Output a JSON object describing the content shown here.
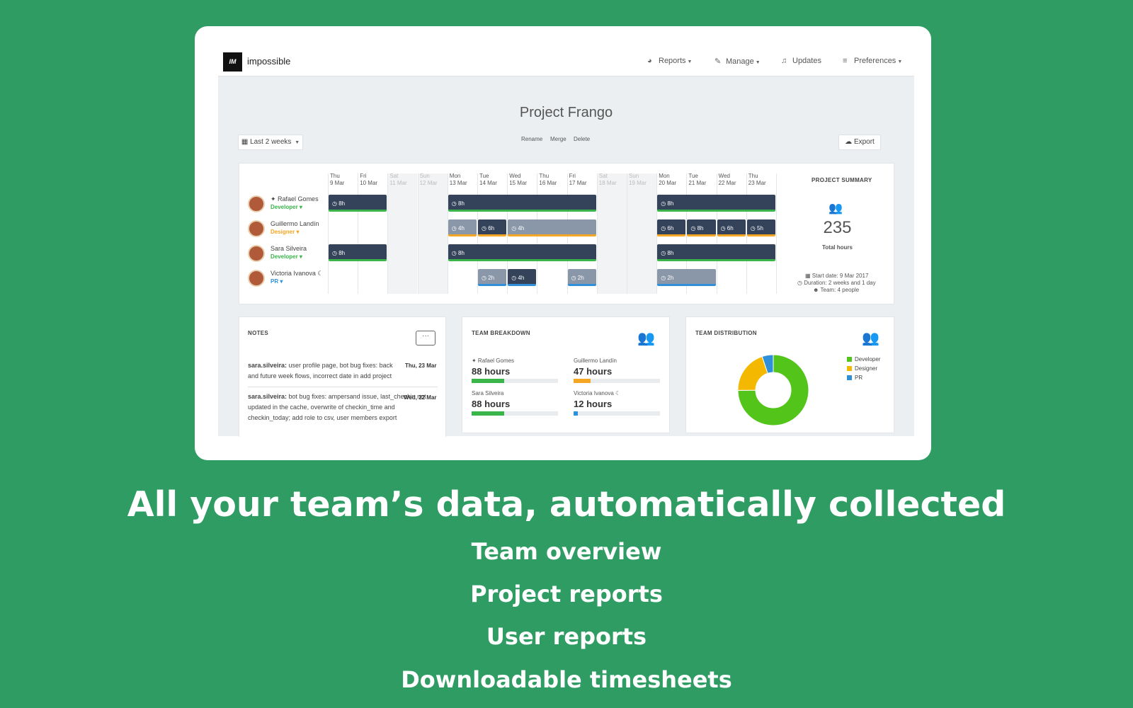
{
  "app": {
    "brand": "impossible",
    "logo_text": "IM",
    "nav": [
      {
        "label": "Reports",
        "icon": "pie-chart-icon"
      },
      {
        "label": "Manage",
        "icon": "wrench-icon"
      },
      {
        "label": "Updates",
        "icon": "bell-icon"
      },
      {
        "label": "Preferences",
        "icon": "sliders-icon"
      }
    ],
    "project_title": "Project Frango",
    "range_button": "Last 2 weeks",
    "actions": {
      "rename": "Rename",
      "merge": "Merge",
      "delete": "Delete"
    },
    "export_button": "Export"
  },
  "schedule": {
    "days": [
      {
        "day": "Thu",
        "date": "9 Mar",
        "weekend": false
      },
      {
        "day": "Fri",
        "date": "10 Mar",
        "weekend": false
      },
      {
        "day": "Sat",
        "date": "11 Mar",
        "weekend": true
      },
      {
        "day": "Sun",
        "date": "12 Mar",
        "weekend": true
      },
      {
        "day": "Mon",
        "date": "13 Mar",
        "weekend": false
      },
      {
        "day": "Tue",
        "date": "14 Mar",
        "weekend": false
      },
      {
        "day": "Wed",
        "date": "15 Mar",
        "weekend": false
      },
      {
        "day": "Thu",
        "date": "16 Mar",
        "weekend": false
      },
      {
        "day": "Fri",
        "date": "17 Mar",
        "weekend": false
      },
      {
        "day": "Sat",
        "date": "18 Mar",
        "weekend": true
      },
      {
        "day": "Sun",
        "date": "19 Mar",
        "weekend": true
      },
      {
        "day": "Mon",
        "date": "20 Mar",
        "weekend": false
      },
      {
        "day": "Tue",
        "date": "21 Mar",
        "weekend": false
      },
      {
        "day": "Wed",
        "date": "22 Mar",
        "weekend": false
      },
      {
        "day": "Thu",
        "date": "23 Mar",
        "weekend": false
      }
    ],
    "people": [
      {
        "name": "Rafael Gomes",
        "role": "Developer",
        "role_color": "#39b54a",
        "prefix": "✦",
        "suffix": ""
      },
      {
        "name": "Guillermo Landín",
        "role": "Designer",
        "role_color": "#f5a623",
        "prefix": "",
        "suffix": ""
      },
      {
        "name": "Sara Silveira",
        "role": "Developer",
        "role_color": "#39b54a",
        "prefix": "",
        "suffix": ""
      },
      {
        "name": "Victoria Ivanova",
        "role": "PR",
        "role_color": "#2f8fd8",
        "prefix": "",
        "suffix": "☾"
      }
    ],
    "blocks": [
      {
        "row": 0,
        "start": 0,
        "span": 2,
        "label": "8h",
        "style": "dark",
        "accent": "green"
      },
      {
        "row": 0,
        "start": 4,
        "span": 5,
        "label": "8h",
        "style": "dark",
        "accent": "green"
      },
      {
        "row": 0,
        "start": 11,
        "span": 4,
        "label": "8h",
        "style": "dark",
        "accent": "green"
      },
      {
        "row": 1,
        "start": 4,
        "span": 1,
        "label": "4h",
        "style": "light",
        "accent": "orange"
      },
      {
        "row": 1,
        "start": 5,
        "span": 1,
        "label": "6h",
        "style": "dark",
        "accent": "orange"
      },
      {
        "row": 1,
        "start": 6,
        "span": 3,
        "label": "4h",
        "style": "light",
        "accent": "orange"
      },
      {
        "row": 1,
        "start": 11,
        "span": 1,
        "label": "6h",
        "style": "dark",
        "accent": "orange"
      },
      {
        "row": 1,
        "start": 12,
        "span": 1,
        "label": "8h",
        "style": "dark",
        "accent": "orange"
      },
      {
        "row": 1,
        "start": 13,
        "span": 1,
        "label": "6h",
        "style": "dark",
        "accent": "orange"
      },
      {
        "row": 1,
        "start": 14,
        "span": 1,
        "label": "5h",
        "style": "dark",
        "accent": "orange"
      },
      {
        "row": 2,
        "start": 0,
        "span": 2,
        "label": "8h",
        "style": "dark",
        "accent": "green"
      },
      {
        "row": 2,
        "start": 4,
        "span": 5,
        "label": "8h",
        "style": "dark",
        "accent": "green"
      },
      {
        "row": 2,
        "start": 11,
        "span": 4,
        "label": "8h",
        "style": "dark",
        "accent": "green"
      },
      {
        "row": 3,
        "start": 5,
        "span": 1,
        "label": "2h",
        "style": "light",
        "accent": "blue"
      },
      {
        "row": 3,
        "start": 6,
        "span": 1,
        "label": "4h",
        "style": "dark",
        "accent": "blue"
      },
      {
        "row": 3,
        "start": 8,
        "span": 1,
        "label": "2h",
        "style": "light",
        "accent": "blue"
      },
      {
        "row": 3,
        "start": 11,
        "span": 2,
        "label": "2h",
        "style": "light",
        "accent": "blue"
      }
    ]
  },
  "summary": {
    "label": "PROJECT SUMMARY",
    "total": "235",
    "total_label": "Total hours",
    "start": "Start date: 9 Mar 2017",
    "duration": "Duration: 2 weeks and 1 day",
    "team": "Team: 4 people"
  },
  "notes": {
    "title": "NOTES",
    "items": [
      {
        "author": "sara.silveira:",
        "text": " user profile page, bot bug fixes: back and future week flows, incorrect date in add project",
        "date": "Thu, 23 Mar"
      },
      {
        "author": "sara.silveira:",
        "text": " bot bug fixes: ampersand issue, last_checkin not updated in the cache, overwrite of checkin_time and checkin_today; add role to csv, user members export",
        "date": "Wed, 22 Mar"
      }
    ]
  },
  "breakdown": {
    "title": "TEAM BREAKDOWN",
    "members": [
      {
        "name": "✦ Rafael Gomes",
        "hours": "88 hours",
        "fraction": 0.38,
        "color": "#39b54a"
      },
      {
        "name": "Guillermo Landín",
        "hours": "47 hours",
        "fraction": 0.2,
        "color": "#f5a623"
      },
      {
        "name": "Sara Silveira",
        "hours": "88 hours",
        "fraction": 0.38,
        "color": "#39b54a"
      },
      {
        "name": "Victoria Ivanova ☾",
        "hours": "12 hours",
        "fraction": 0.05,
        "color": "#2f8fd8"
      }
    ]
  },
  "distribution": {
    "title": "TEAM DISTRIBUTION",
    "legend": [
      {
        "label": "Developer",
        "color": "#52c41a",
        "value": 176
      },
      {
        "label": "Designer",
        "color": "#f5b800",
        "value": 47
      },
      {
        "label": "PR",
        "color": "#2f8fd8",
        "value": 12
      }
    ]
  },
  "marketing": {
    "headline": "All your team’s data, automatically collected",
    "features": [
      "Team overview",
      "Project reports",
      "User reports",
      "Downloadable timesheets"
    ]
  }
}
